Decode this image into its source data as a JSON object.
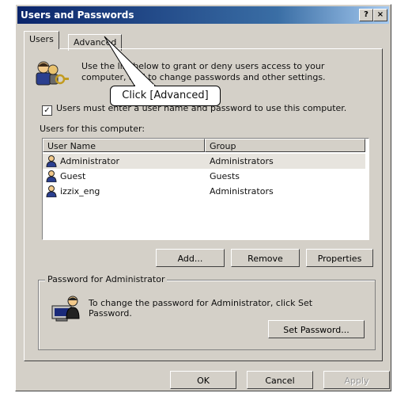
{
  "window": {
    "title": "Users and Passwords",
    "help_glyph": "?",
    "close_glyph": "×"
  },
  "tabs": [
    {
      "label": "Users"
    },
    {
      "label": "Advanced"
    }
  ],
  "intro": "Use the list below to grant or deny users access to your computer, and to change passwords and other settings.",
  "must_login": {
    "label": "Users must enter a user name and password to use this computer.",
    "checked": true,
    "check_glyph": "✓"
  },
  "users_label": "Users for this computer:",
  "list": {
    "headers": [
      "User Name",
      "Group"
    ],
    "rows": [
      {
        "name": "Administrator",
        "group": "Administrators"
      },
      {
        "name": "Guest",
        "group": "Guests"
      },
      {
        "name": "izzix_eng",
        "group": "Administrators"
      }
    ]
  },
  "buttons": {
    "add": "Add...",
    "remove": "Remove",
    "properties": "Properties",
    "set_password": "Set Password...",
    "ok": "OK",
    "cancel": "Cancel",
    "apply": "Apply"
  },
  "password_group": {
    "label": "Password for Administrator",
    "text": "To change the password for Administrator, click Set Password."
  },
  "callout": "Click [Advanced]",
  "icons": {
    "users": "users-key-icon",
    "user": "user-icon",
    "admin": "admin-computer-icon"
  },
  "colors": {
    "titlebar_start": "#0a246a",
    "titlebar_end": "#a6caf0",
    "face": "#d4d0c8"
  }
}
